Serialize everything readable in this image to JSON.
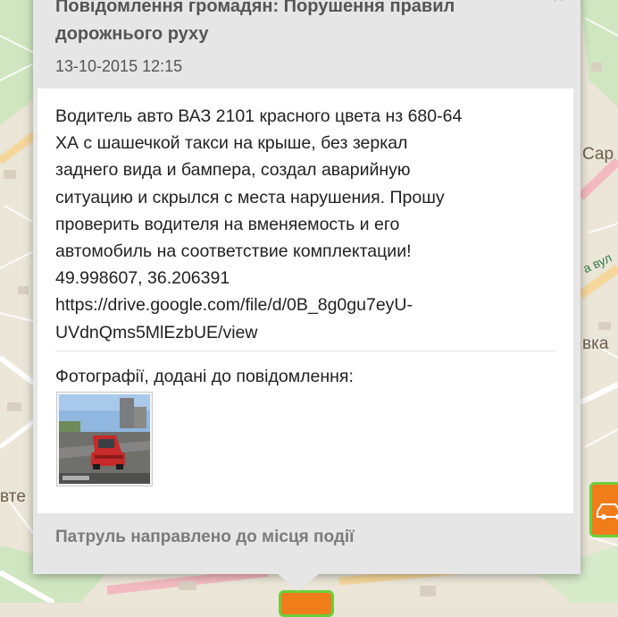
{
  "popup": {
    "title": "Повідомлення громадян: Порушення правил дорожнього руху",
    "date": "13-10-2015 12:15",
    "description": "Водитель авто ВАЗ 2101 красного цвета нз 680-64\nХА с шашечкой такси на крыше, без зеркал\nзаднего вида и бампера, создал аварийную\nситуацию и скрылся с места нарушения. Прошу\nпроверить водителя на вменяемость и его\nавтомобиль на соответствие комплектации!\n49.998607, 36.206391\nhttps://drive.google.com/file/d/0B_8g0gu7eyU-\nUVdnQms5MlEzbUE/view",
    "photos_label": "Фотографії, додані до повідомлення:",
    "status": "Патруль направлено до місця події",
    "close_icon": "close-icon"
  },
  "map": {
    "labels": [
      "Сар",
      "вка",
      "втe",
      "а вул"
    ]
  },
  "markers": {
    "icon": "car-icon",
    "color": "#f07d1a",
    "border_color": "#6ccf3a"
  }
}
